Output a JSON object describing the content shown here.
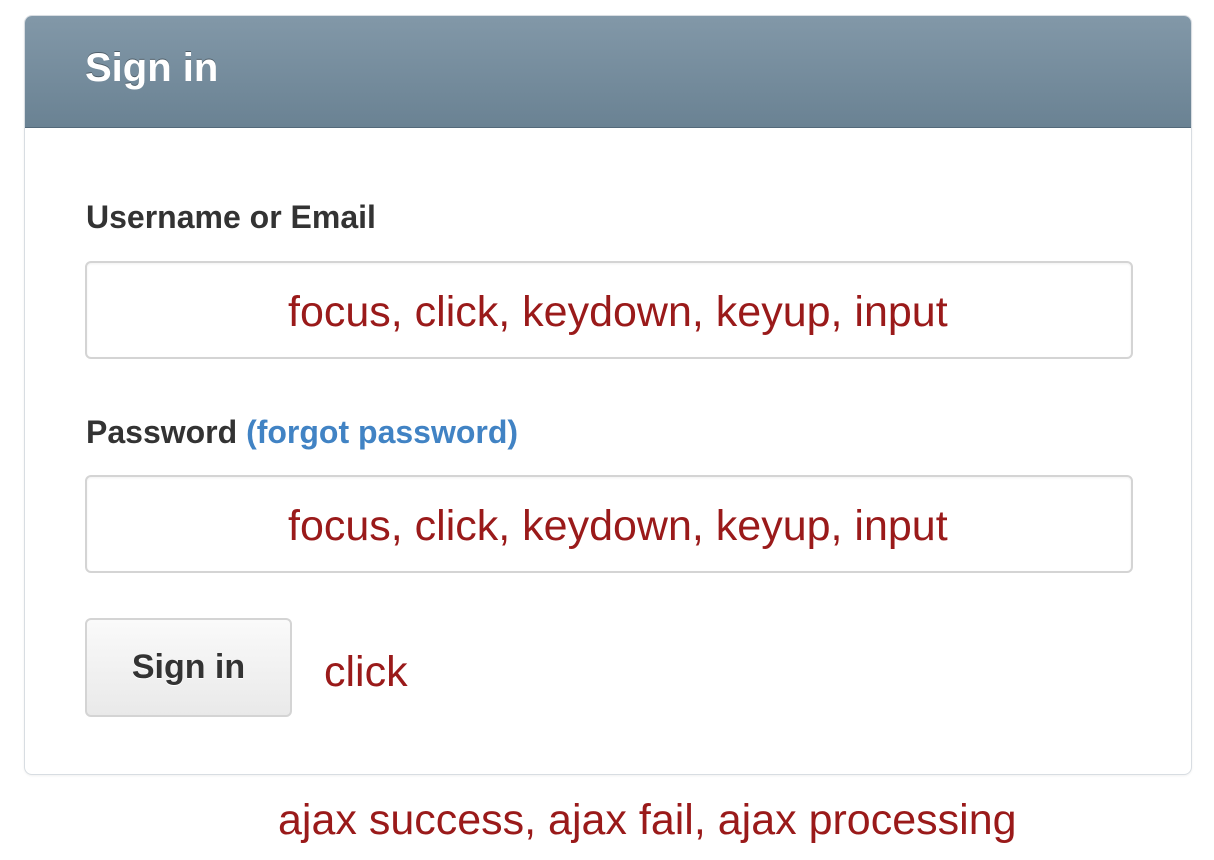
{
  "login_panel": {
    "title": "Sign in",
    "username_label": "Username or Email",
    "password_label": "Password",
    "forgot_link": "(forgot password)",
    "username_input": {
      "value": "",
      "placeholder": ""
    },
    "password_input": {
      "value": "",
      "placeholder": ""
    },
    "submit_label": "Sign in"
  },
  "annotations": {
    "username_events": "focus, click, keydown, keyup, input",
    "password_events": "focus, click, keydown, keyup, input",
    "button_events": "click",
    "ajax_events": "ajax success, ajax fail, ajax processing"
  },
  "colors": {
    "header_gradient_top": "#8298a8",
    "header_gradient_bottom": "#6a8293",
    "annotation_text": "#9a1a1a",
    "link": "#4183c4",
    "label_text": "#333333"
  }
}
